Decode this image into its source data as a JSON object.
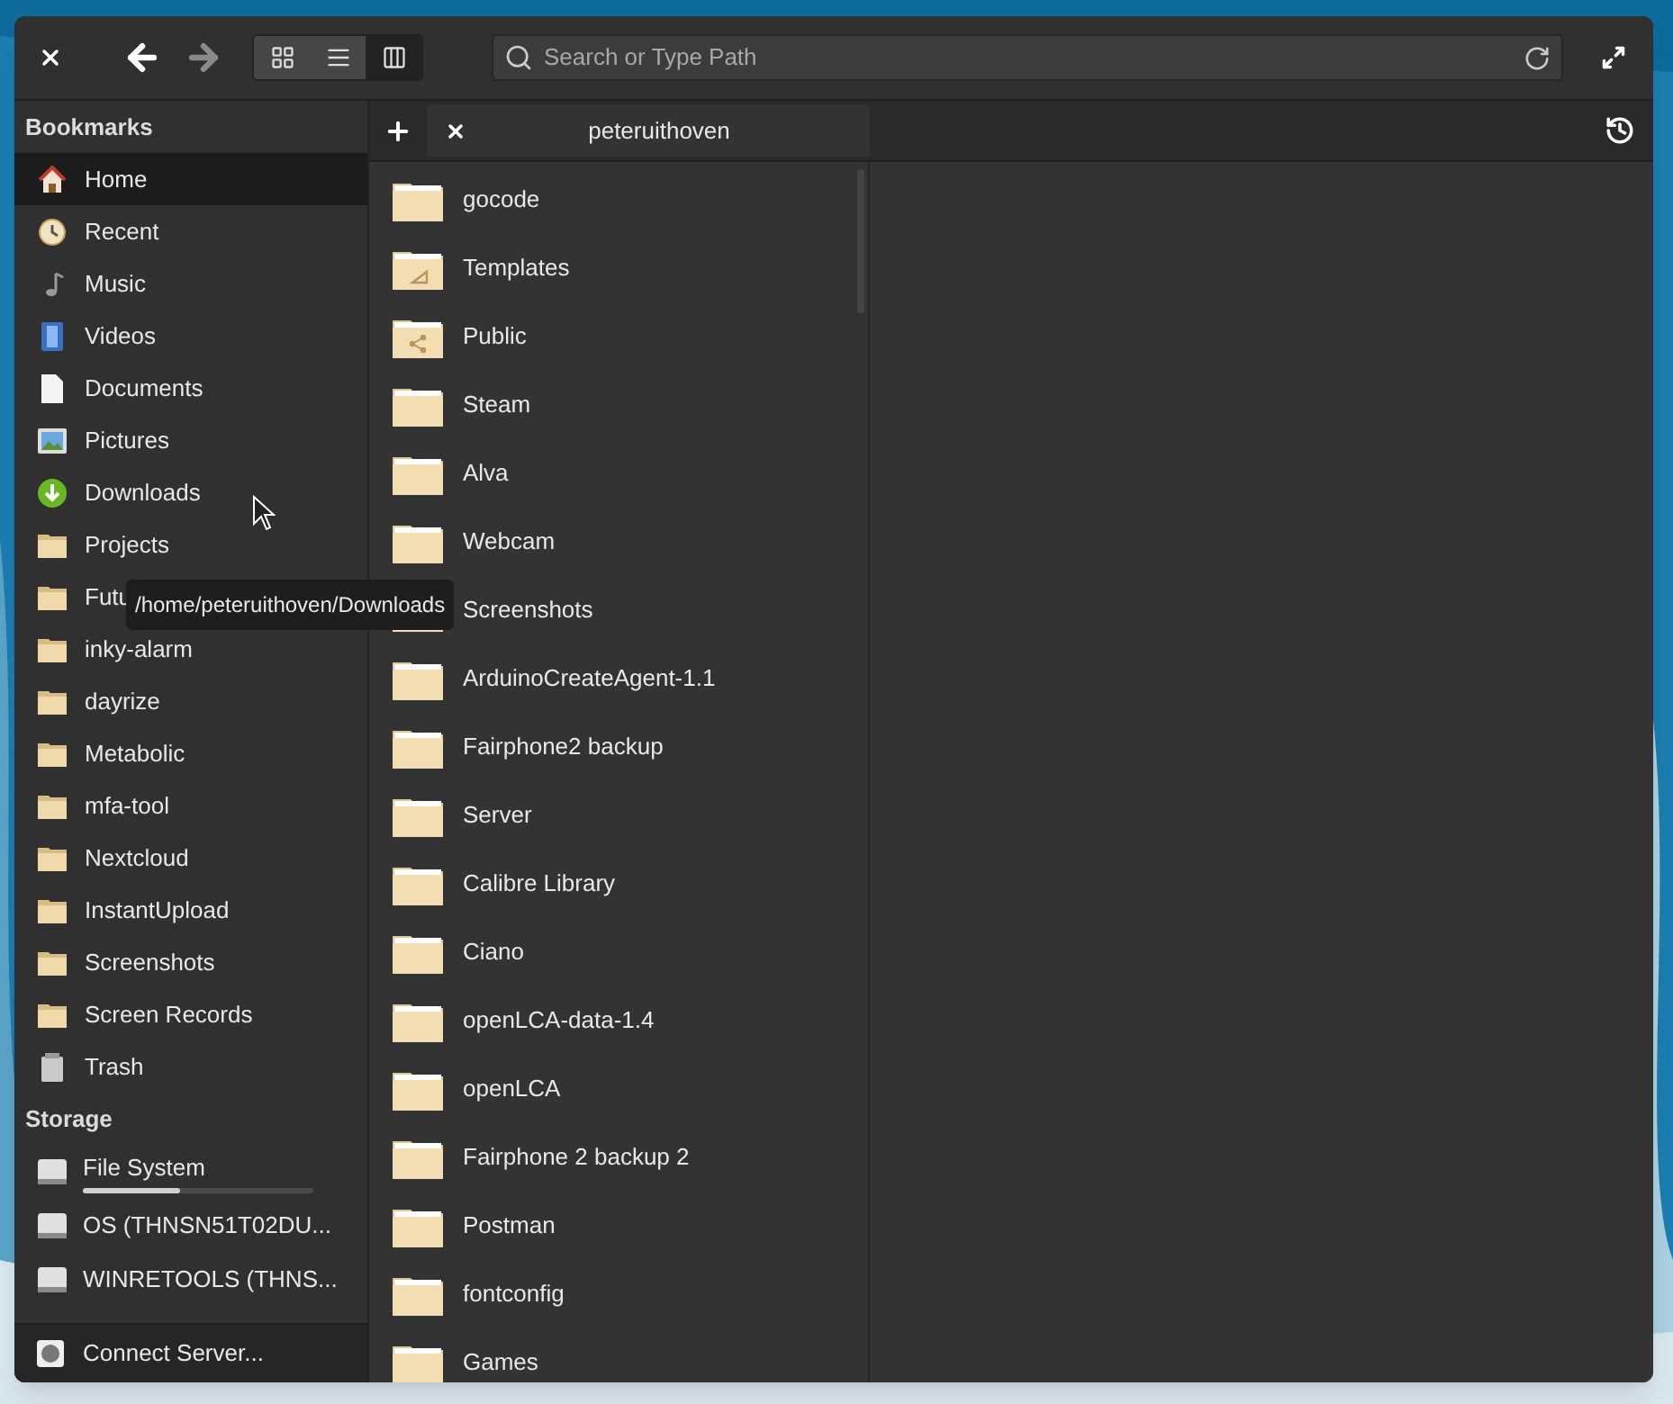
{
  "toolbar": {
    "view_modes": [
      {
        "selected": false
      },
      {
        "selected": false
      },
      {
        "selected": true
      }
    ],
    "search": {
      "placeholder": "Search or Type Path"
    }
  },
  "sidebar": {
    "bookmarks_title": "Bookmarks",
    "bookmarks": [
      {
        "label": "Home",
        "selected": true
      },
      {
        "label": "Recent",
        "selected": false
      },
      {
        "label": "Music",
        "selected": false
      },
      {
        "label": "Videos",
        "selected": false
      },
      {
        "label": "Documents",
        "selected": false
      },
      {
        "label": "Pictures",
        "selected": false
      },
      {
        "label": "Downloads",
        "selected": false
      },
      {
        "label": "Projects",
        "selected": false
      },
      {
        "label": "Futu",
        "selected": false
      },
      {
        "label": "inky-alarm",
        "selected": false
      },
      {
        "label": "dayrize",
        "selected": false
      },
      {
        "label": "Metabolic",
        "selected": false
      },
      {
        "label": "mfa-tool",
        "selected": false
      },
      {
        "label": "Nextcloud",
        "selected": false
      },
      {
        "label": "InstantUpload",
        "selected": false
      },
      {
        "label": "Screenshots",
        "selected": false
      },
      {
        "label": "Screen Records",
        "selected": false
      },
      {
        "label": "Trash",
        "selected": false
      }
    ],
    "storage_title": "Storage",
    "storage": [
      {
        "label": "File System",
        "level": 0.42
      },
      {
        "label": "OS (THNSN51T02DU..."
      },
      {
        "label": "WINRETOOLS (THNS..."
      }
    ],
    "connect_server": "Connect Server..."
  },
  "tabs": [
    {
      "label": "peteruithoven",
      "selected": true
    }
  ],
  "files": [
    "gocode",
    "Templates",
    "Public",
    "Steam",
    "Alva",
    "Webcam",
    "Screenshots",
    "ArduinoCreateAgent-1.1",
    "Fairphone2 backup",
    "Server",
    "Calibre Library",
    "Ciano",
    "openLCA-data-1.4",
    "openLCA",
    "Fairphone 2 backup 2",
    "Postman",
    "fontconfig",
    "Games"
  ],
  "tooltip": "/home/peteruithoven/Downloads"
}
